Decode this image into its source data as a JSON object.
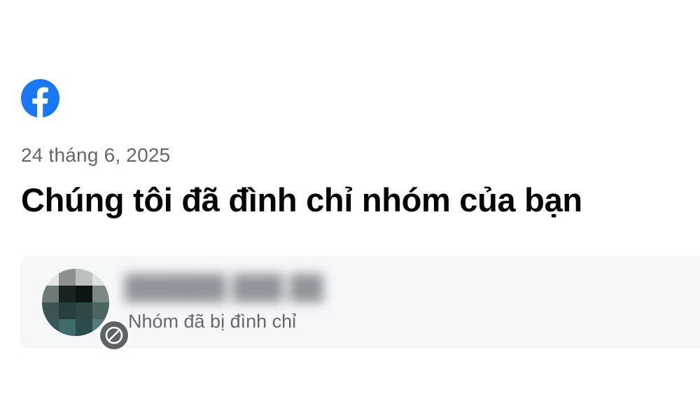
{
  "brand": {
    "logo_icon": "facebook-logo-icon",
    "color": "#1877f2"
  },
  "notice": {
    "date": "24 tháng 6, 2025",
    "title": "Chúng tôi đã đình chỉ nhóm của bạn"
  },
  "group": {
    "name": "██████ ███ ██",
    "name_obscured": true,
    "status": "Nhóm đã bị đình chỉ",
    "avatar_icon": "group-avatar",
    "badge_icon": "suspended-icon"
  }
}
